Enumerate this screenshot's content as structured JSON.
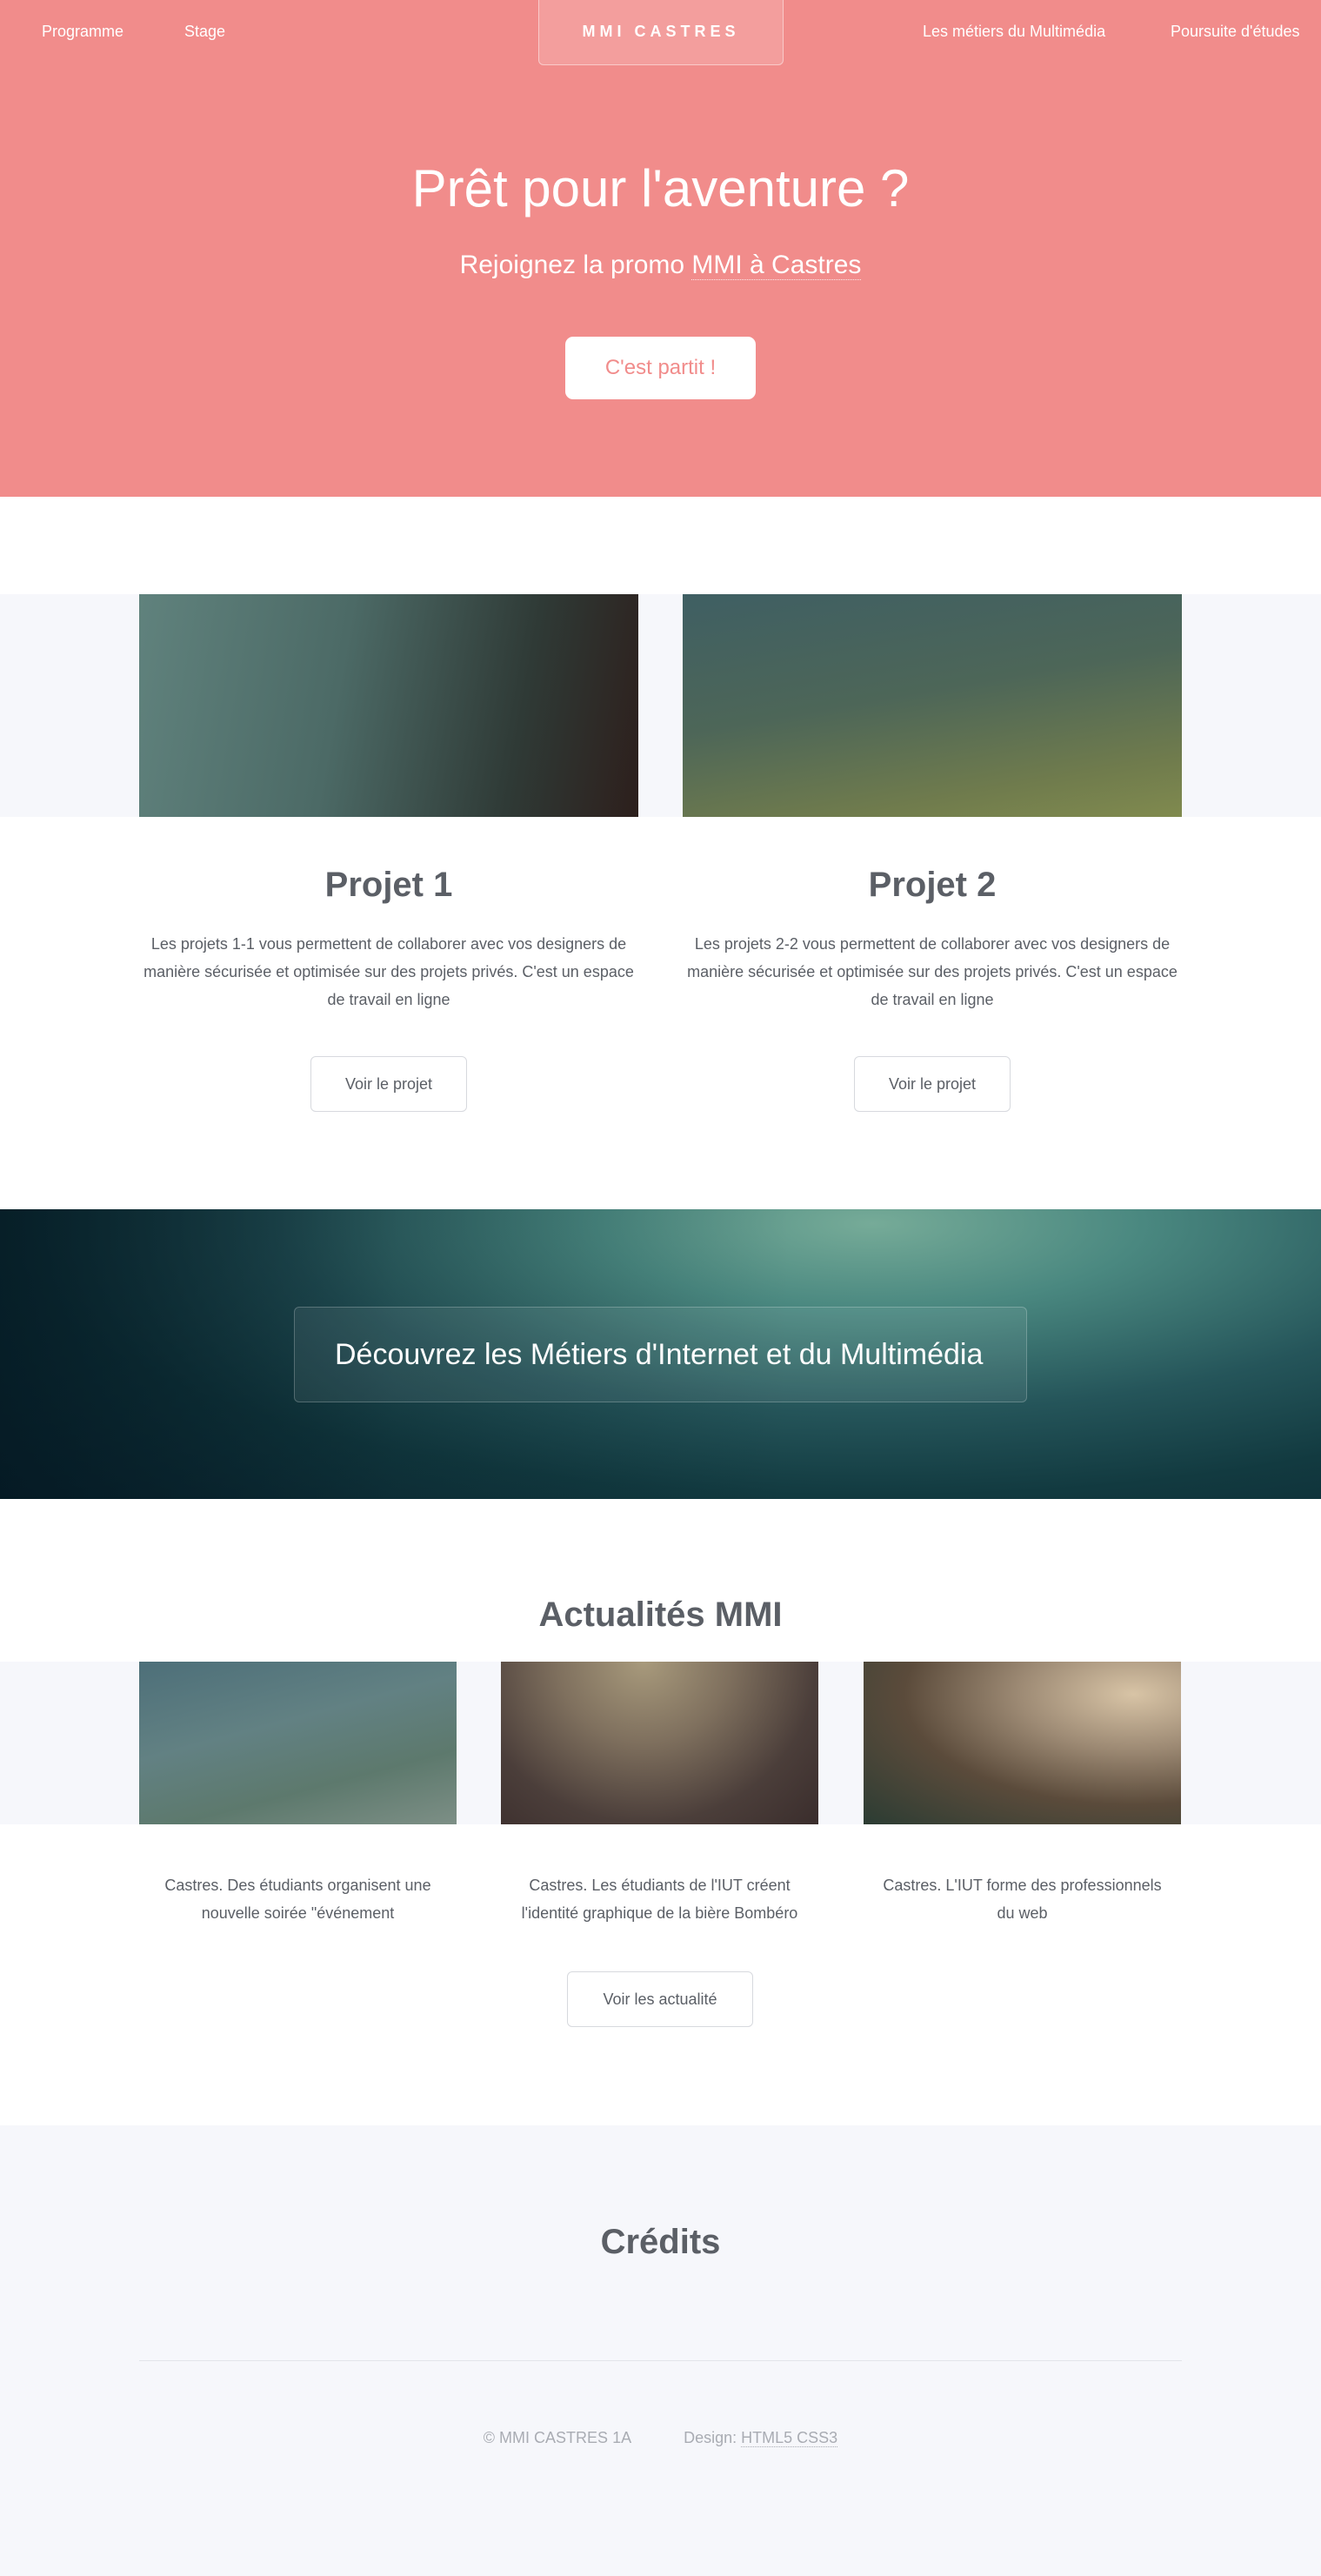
{
  "nav": {
    "left": [
      "Programme",
      "Stage"
    ],
    "logo": "MMI CASTRES",
    "right": [
      "Les métiers du Multimédia",
      "Poursuite d'études"
    ]
  },
  "hero": {
    "title": "Prêt pour l'aventure ?",
    "subtitle_prefix": "Rejoignez la promo ",
    "subtitle_link": "MMI à Castres",
    "cta": "C'est partit !"
  },
  "projects": [
    {
      "title": "Projet 1",
      "text": "Les projets 1-1 vous permettent de collaborer avec vos designers de manière sécurisée et optimisée sur des projets privés. C'est un espace de travail en ligne",
      "button": "Voir le projet"
    },
    {
      "title": "Projet 2",
      "text": "Les projets 2-2 vous permettent de collaborer avec vos designers de manière sécurisée et optimisée sur des projets privés. C'est un espace de travail en ligne",
      "button": "Voir le projet"
    }
  ],
  "banner": {
    "text": "Découvrez les Métiers d'Internet et du Multimédia"
  },
  "news": {
    "title": "Actualités MMI",
    "items": [
      "Castres. Des étudiants organisent une nouvelle soirée \"événement",
      "Castres. Les étudiants de l'IUT créent l'identité graphique de la bière Bombéro",
      "Castres. L'IUT forme des professionnels du web"
    ],
    "button": "Voir les actualité"
  },
  "credits": {
    "title": "Crédits"
  },
  "footer": {
    "copyright": "© MMI CASTRES 1A",
    "design_label": "Design: ",
    "design_link": "HTML5 CSS3"
  },
  "colors": {
    "hero_bg": "#f18c8b",
    "text": "#5b5f66",
    "light_band": "#f6f7fb"
  }
}
